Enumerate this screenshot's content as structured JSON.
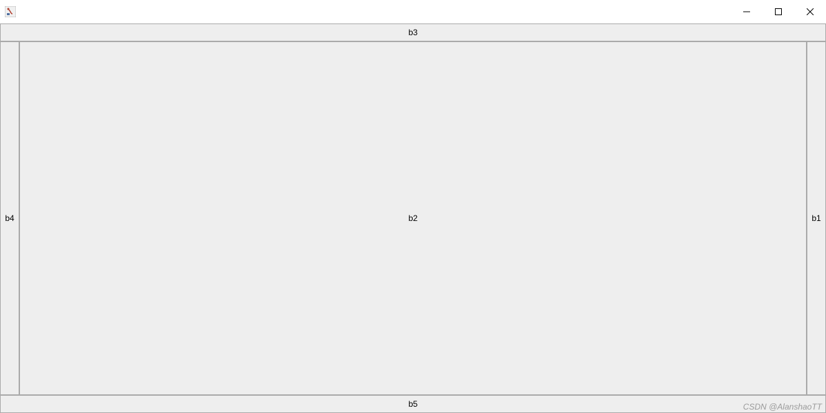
{
  "titlebar": {
    "title": ""
  },
  "layout": {
    "top": "b3",
    "bottom": "b5",
    "left": "b4",
    "right": "b1",
    "center": "b2"
  },
  "watermark": "CSDN @AlanshaoTT"
}
